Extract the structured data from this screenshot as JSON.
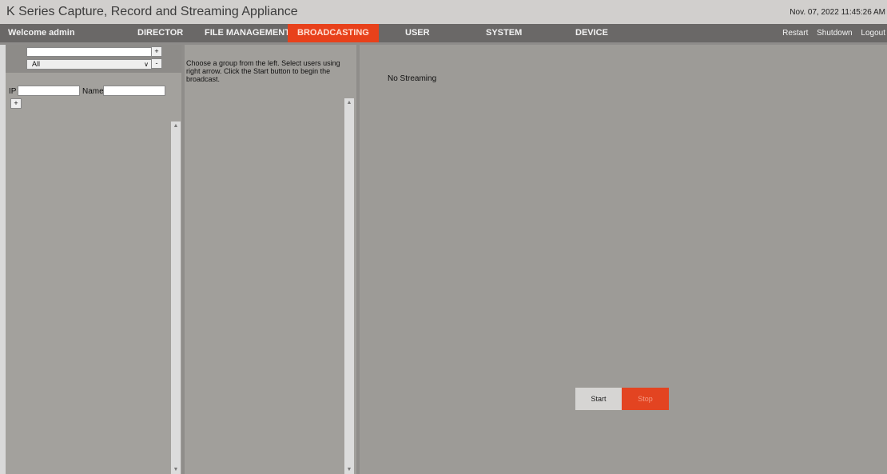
{
  "app": {
    "title": "K Series Capture, Record and Streaming Appliance",
    "datetime": "Nov. 07, 2022 11:45:26 AM"
  },
  "nav": {
    "welcome": "Welcome admin",
    "items": [
      {
        "label": "DIRECTOR",
        "active": false
      },
      {
        "label": "FILE MANAGEMENT",
        "active": false
      },
      {
        "label": "BROADCASTING",
        "active": true
      },
      {
        "label": "USER",
        "active": false
      },
      {
        "label": "SYSTEM",
        "active": false
      },
      {
        "label": "DEVICE",
        "active": false
      }
    ],
    "right": [
      "Restart",
      "Shutdown",
      "Logout"
    ]
  },
  "left": {
    "group_input_value": "",
    "add_label": "+",
    "remove_label": "-",
    "group_select_value": "All",
    "ip_label": "IP",
    "ip_value": "",
    "name_label": "Name",
    "name_value": "",
    "add_user_label": "+"
  },
  "middle": {
    "instructions": "Choose a group from the left. Select users using right arrow. Click the Start button to begin the broadcast."
  },
  "right": {
    "status": "No Streaming",
    "start_label": "Start",
    "stop_label": "Stop"
  },
  "colors": {
    "accent": "#e8411b",
    "navbar": "#6a6867",
    "panel": "#9d9b97"
  },
  "icons": {
    "scroll_up": "▲",
    "scroll_down": "▼",
    "select_chevron": "∨"
  }
}
